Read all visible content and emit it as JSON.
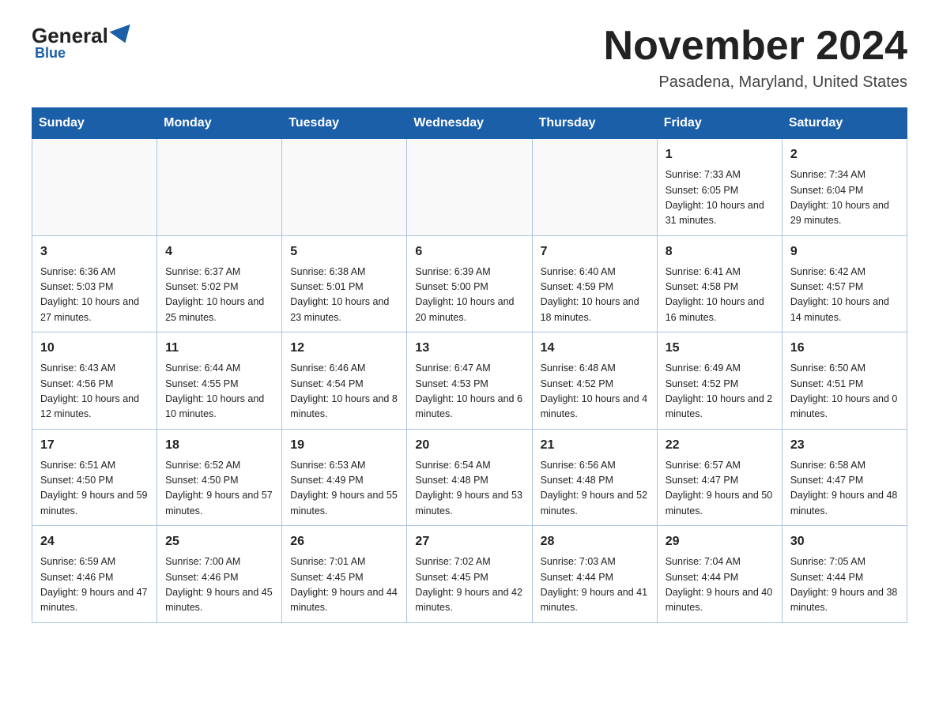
{
  "header": {
    "logo_general": "General",
    "logo_blue": "Blue",
    "month_title": "November 2024",
    "location": "Pasadena, Maryland, United States"
  },
  "weekdays": [
    "Sunday",
    "Monday",
    "Tuesday",
    "Wednesday",
    "Thursday",
    "Friday",
    "Saturday"
  ],
  "weeks": [
    [
      {
        "day": "",
        "info": ""
      },
      {
        "day": "",
        "info": ""
      },
      {
        "day": "",
        "info": ""
      },
      {
        "day": "",
        "info": ""
      },
      {
        "day": "",
        "info": ""
      },
      {
        "day": "1",
        "info": "Sunrise: 7:33 AM\nSunset: 6:05 PM\nDaylight: 10 hours and 31 minutes."
      },
      {
        "day": "2",
        "info": "Sunrise: 7:34 AM\nSunset: 6:04 PM\nDaylight: 10 hours and 29 minutes."
      }
    ],
    [
      {
        "day": "3",
        "info": "Sunrise: 6:36 AM\nSunset: 5:03 PM\nDaylight: 10 hours and 27 minutes."
      },
      {
        "day": "4",
        "info": "Sunrise: 6:37 AM\nSunset: 5:02 PM\nDaylight: 10 hours and 25 minutes."
      },
      {
        "day": "5",
        "info": "Sunrise: 6:38 AM\nSunset: 5:01 PM\nDaylight: 10 hours and 23 minutes."
      },
      {
        "day": "6",
        "info": "Sunrise: 6:39 AM\nSunset: 5:00 PM\nDaylight: 10 hours and 20 minutes."
      },
      {
        "day": "7",
        "info": "Sunrise: 6:40 AM\nSunset: 4:59 PM\nDaylight: 10 hours and 18 minutes."
      },
      {
        "day": "8",
        "info": "Sunrise: 6:41 AM\nSunset: 4:58 PM\nDaylight: 10 hours and 16 minutes."
      },
      {
        "day": "9",
        "info": "Sunrise: 6:42 AM\nSunset: 4:57 PM\nDaylight: 10 hours and 14 minutes."
      }
    ],
    [
      {
        "day": "10",
        "info": "Sunrise: 6:43 AM\nSunset: 4:56 PM\nDaylight: 10 hours and 12 minutes."
      },
      {
        "day": "11",
        "info": "Sunrise: 6:44 AM\nSunset: 4:55 PM\nDaylight: 10 hours and 10 minutes."
      },
      {
        "day": "12",
        "info": "Sunrise: 6:46 AM\nSunset: 4:54 PM\nDaylight: 10 hours and 8 minutes."
      },
      {
        "day": "13",
        "info": "Sunrise: 6:47 AM\nSunset: 4:53 PM\nDaylight: 10 hours and 6 minutes."
      },
      {
        "day": "14",
        "info": "Sunrise: 6:48 AM\nSunset: 4:52 PM\nDaylight: 10 hours and 4 minutes."
      },
      {
        "day": "15",
        "info": "Sunrise: 6:49 AM\nSunset: 4:52 PM\nDaylight: 10 hours and 2 minutes."
      },
      {
        "day": "16",
        "info": "Sunrise: 6:50 AM\nSunset: 4:51 PM\nDaylight: 10 hours and 0 minutes."
      }
    ],
    [
      {
        "day": "17",
        "info": "Sunrise: 6:51 AM\nSunset: 4:50 PM\nDaylight: 9 hours and 59 minutes."
      },
      {
        "day": "18",
        "info": "Sunrise: 6:52 AM\nSunset: 4:50 PM\nDaylight: 9 hours and 57 minutes."
      },
      {
        "day": "19",
        "info": "Sunrise: 6:53 AM\nSunset: 4:49 PM\nDaylight: 9 hours and 55 minutes."
      },
      {
        "day": "20",
        "info": "Sunrise: 6:54 AM\nSunset: 4:48 PM\nDaylight: 9 hours and 53 minutes."
      },
      {
        "day": "21",
        "info": "Sunrise: 6:56 AM\nSunset: 4:48 PM\nDaylight: 9 hours and 52 minutes."
      },
      {
        "day": "22",
        "info": "Sunrise: 6:57 AM\nSunset: 4:47 PM\nDaylight: 9 hours and 50 minutes."
      },
      {
        "day": "23",
        "info": "Sunrise: 6:58 AM\nSunset: 4:47 PM\nDaylight: 9 hours and 48 minutes."
      }
    ],
    [
      {
        "day": "24",
        "info": "Sunrise: 6:59 AM\nSunset: 4:46 PM\nDaylight: 9 hours and 47 minutes."
      },
      {
        "day": "25",
        "info": "Sunrise: 7:00 AM\nSunset: 4:46 PM\nDaylight: 9 hours and 45 minutes."
      },
      {
        "day": "26",
        "info": "Sunrise: 7:01 AM\nSunset: 4:45 PM\nDaylight: 9 hours and 44 minutes."
      },
      {
        "day": "27",
        "info": "Sunrise: 7:02 AM\nSunset: 4:45 PM\nDaylight: 9 hours and 42 minutes."
      },
      {
        "day": "28",
        "info": "Sunrise: 7:03 AM\nSunset: 4:44 PM\nDaylight: 9 hours and 41 minutes."
      },
      {
        "day": "29",
        "info": "Sunrise: 7:04 AM\nSunset: 4:44 PM\nDaylight: 9 hours and 40 minutes."
      },
      {
        "day": "30",
        "info": "Sunrise: 7:05 AM\nSunset: 4:44 PM\nDaylight: 9 hours and 38 minutes."
      }
    ]
  ]
}
